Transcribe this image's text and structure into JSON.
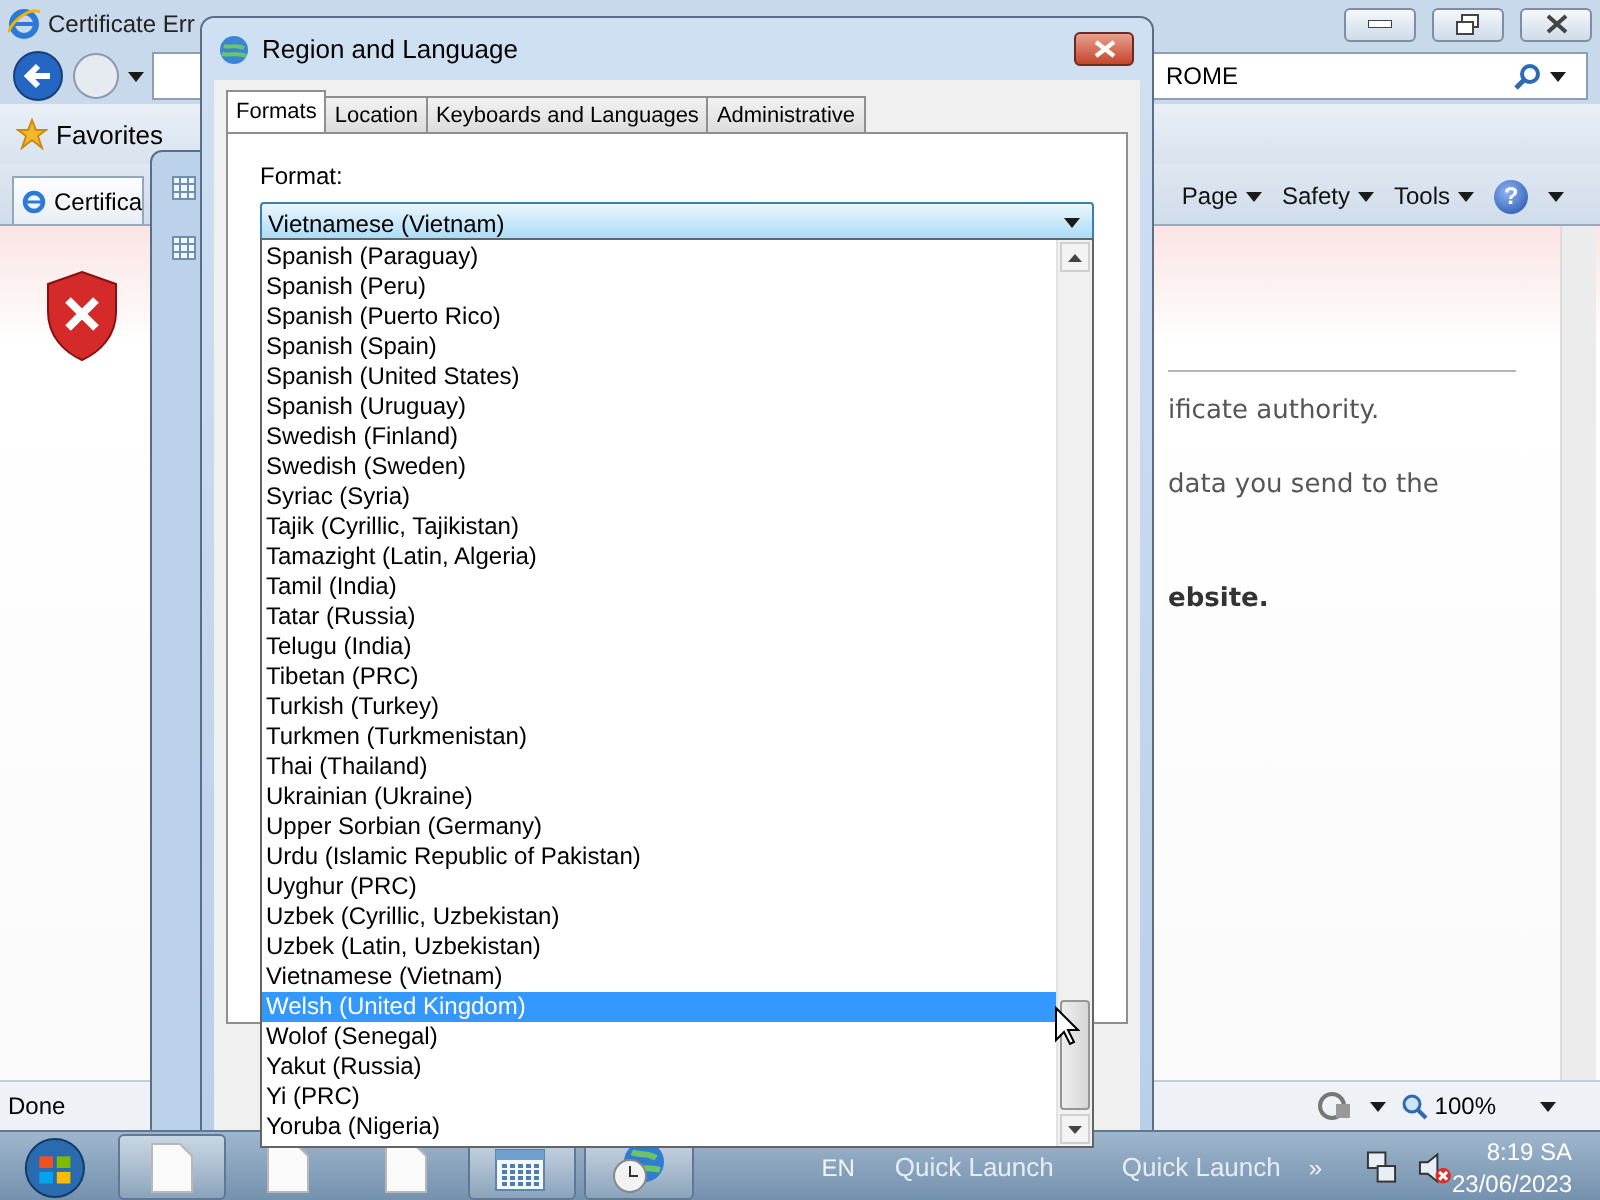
{
  "browser": {
    "title": "Certificate Err",
    "address": "ROME",
    "favorites": "Favorites",
    "tab": "Certifica",
    "commands": [
      {
        "label": "Page"
      },
      {
        "label": "Safety"
      },
      {
        "label": "Tools"
      }
    ],
    "help": "?",
    "content": [
      {
        "text": "ificate authority.",
        "bold": false
      },
      {
        "text": "data you send to the",
        "bold": false
      },
      {
        "text": "ebsite.",
        "bold": true
      }
    ],
    "status": "Done",
    "zoom": "100%"
  },
  "dialog": {
    "title": "Region and Language",
    "tabs": [
      {
        "label": "Formats",
        "selected": true
      },
      {
        "label": "Location",
        "selected": false
      },
      {
        "label": "Keyboards and Languages",
        "selected": false
      },
      {
        "label": "Administrative",
        "selected": false
      }
    ],
    "format_label": "Format:",
    "format_value": "Vietnamese (Vietnam)",
    "options": [
      {
        "label": "Spanish (Paraguay)",
        "selected": false
      },
      {
        "label": "Spanish (Peru)",
        "selected": false
      },
      {
        "label": "Spanish (Puerto Rico)",
        "selected": false
      },
      {
        "label": "Spanish (Spain)",
        "selected": false
      },
      {
        "label": "Spanish (United States)",
        "selected": false
      },
      {
        "label": "Spanish (Uruguay)",
        "selected": false
      },
      {
        "label": "Swedish (Finland)",
        "selected": false
      },
      {
        "label": "Swedish (Sweden)",
        "selected": false
      },
      {
        "label": "Syriac (Syria)",
        "selected": false
      },
      {
        "label": "Tajik (Cyrillic, Tajikistan)",
        "selected": false
      },
      {
        "label": "Tamazight (Latin, Algeria)",
        "selected": false
      },
      {
        "label": "Tamil (India)",
        "selected": false
      },
      {
        "label": "Tatar (Russia)",
        "selected": false
      },
      {
        "label": "Telugu (India)",
        "selected": false
      },
      {
        "label": "Tibetan (PRC)",
        "selected": false
      },
      {
        "label": "Turkish (Turkey)",
        "selected": false
      },
      {
        "label": "Turkmen (Turkmenistan)",
        "selected": false
      },
      {
        "label": "Thai (Thailand)",
        "selected": false
      },
      {
        "label": "Ukrainian (Ukraine)",
        "selected": false
      },
      {
        "label": "Upper Sorbian (Germany)",
        "selected": false
      },
      {
        "label": "Urdu (Islamic Republic of Pakistan)",
        "selected": false
      },
      {
        "label": "Uyghur (PRC)",
        "selected": false
      },
      {
        "label": "Uzbek (Cyrillic, Uzbekistan)",
        "selected": false
      },
      {
        "label": "Uzbek (Latin, Uzbekistan)",
        "selected": false
      },
      {
        "label": "Vietnamese (Vietnam)",
        "selected": false
      },
      {
        "label": "Welsh (United Kingdom)",
        "selected": true
      },
      {
        "label": "Wolof (Senegal)",
        "selected": false
      },
      {
        "label": "Yakut (Russia)",
        "selected": false
      },
      {
        "label": "Yi (PRC)",
        "selected": false
      },
      {
        "label": "Yoruba (Nigeria)",
        "selected": false
      }
    ]
  },
  "taskbar": {
    "tasks": [
      {
        "kind": "document",
        "active": true
      },
      {
        "kind": "document",
        "active": false
      },
      {
        "kind": "document",
        "active": false
      },
      {
        "kind": "calendar",
        "active": true
      },
      {
        "kind": "clock",
        "active": true
      }
    ],
    "language": "EN",
    "toolbars": [
      "Quick Launch",
      "Quick Launch"
    ],
    "overflow": "»",
    "time": "8:19 SA",
    "date": "23/06/2023"
  }
}
